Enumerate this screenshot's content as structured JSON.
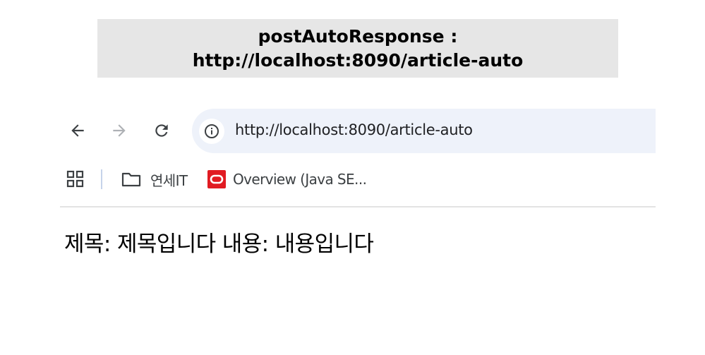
{
  "caption": {
    "line1": "postAutoResponse :",
    "line2": "http://localhost:8090/article-auto"
  },
  "toolbar": {
    "url": "http://localhost:8090/article-auto",
    "back_icon": "back-arrow-icon",
    "forward_icon": "forward-arrow-icon",
    "reload_icon": "reload-icon",
    "info_icon": "info-icon"
  },
  "bookmarks": {
    "apps_icon": "apps-grid-icon",
    "items": [
      {
        "label": "연세IT",
        "icon": "folder-icon"
      },
      {
        "label": "Overview (Java SE...",
        "icon": "oracle-icon"
      }
    ]
  },
  "page": {
    "content": "제목: 제목입니다 내용: 내용입니다"
  },
  "colors": {
    "caption_bg": "#e6e6e6",
    "omnibox_bg": "#eef2fa",
    "oracle_red": "#e11b22",
    "icon_dark": "#5f6368",
    "icon_disabled": "#aeb1b5"
  }
}
